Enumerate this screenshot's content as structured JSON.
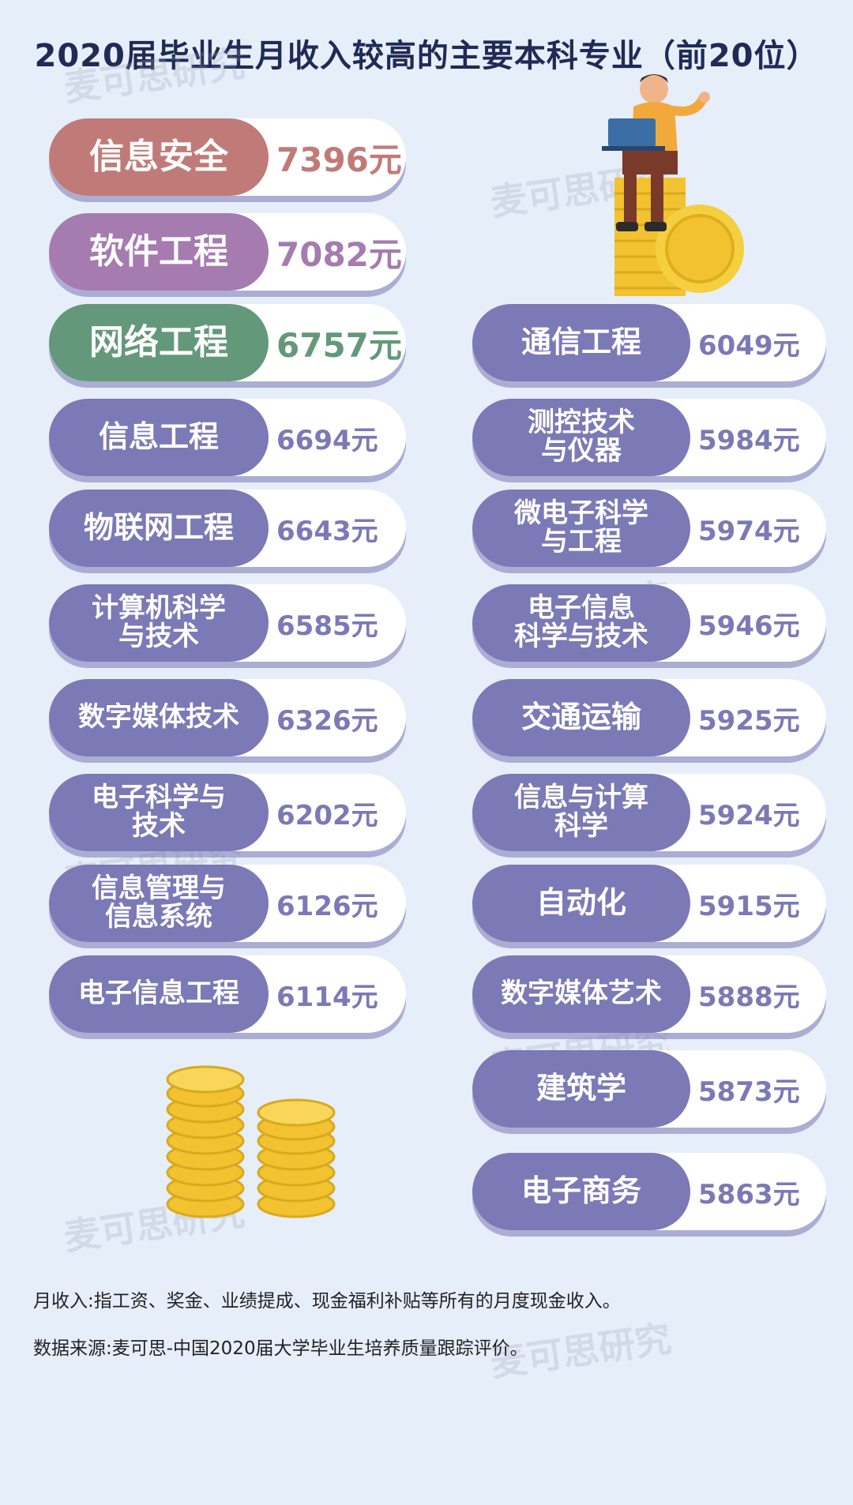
{
  "title": "2020届毕业生月收入较高的主要本科专业（前20位）",
  "watermark": "麦可思研究",
  "colors": {
    "background": "#e6eefa",
    "title": "#1f2a55",
    "rank1": "#c07b78",
    "rank2": "#a57bb0",
    "rank3": "#63997a",
    "default": "#7b79b6",
    "coin": "#f2c230"
  },
  "left_items": [
    {
      "name": "信息安全",
      "value": "7396元",
      "color": "#c07b78"
    },
    {
      "name": "软件工程",
      "value": "7082元",
      "color": "#a57bb0"
    },
    {
      "name": "网络工程",
      "value": "6757元",
      "color": "#63997a"
    },
    {
      "name": "信息工程",
      "value": "6694元",
      "color": "#7b79b6"
    },
    {
      "name": "物联网工程",
      "value": "6643元",
      "color": "#7b79b6"
    },
    {
      "name": "计算机科学\n与技术",
      "value": "6585元",
      "color": "#7b79b6"
    },
    {
      "name": "数字媒体技术",
      "value": "6326元",
      "color": "#7b79b6"
    },
    {
      "name": "电子科学与\n技术",
      "value": "6202元",
      "color": "#7b79b6"
    },
    {
      "name": "信息管理与\n信息系统",
      "value": "6126元",
      "color": "#7b79b6"
    },
    {
      "name": "电子信息工程",
      "value": "6114元",
      "color": "#7b79b6"
    }
  ],
  "right_items": [
    {
      "name": "通信工程",
      "value": "6049元",
      "color": "#7b79b6"
    },
    {
      "name": "测控技术\n与仪器",
      "value": "5984元",
      "color": "#7b79b6"
    },
    {
      "name": "微电子科学\n与工程",
      "value": "5974元",
      "color": "#7b79b6"
    },
    {
      "name": "电子信息\n科学与技术",
      "value": "5946元",
      "color": "#7b79b6"
    },
    {
      "name": "交通运输",
      "value": "5925元",
      "color": "#7b79b6"
    },
    {
      "name": "信息与计算\n科学",
      "value": "5924元",
      "color": "#7b79b6"
    },
    {
      "name": "自动化",
      "value": "5915元",
      "color": "#7b79b6"
    },
    {
      "name": "数字媒体艺术",
      "value": "5888元",
      "color": "#7b79b6"
    },
    {
      "name": "建筑学",
      "value": "5873元",
      "color": "#7b79b6"
    },
    {
      "name": "电子商务",
      "value": "5863元",
      "color": "#7b79b6"
    }
  ],
  "notes": {
    "definition": "月收入:指工资、奖金、业绩提成、现金福利补贴等所有的月度现金收入。",
    "source": "数据来源:麦可思-中国2020届大学毕业生培养质量跟踪评价。"
  }
}
